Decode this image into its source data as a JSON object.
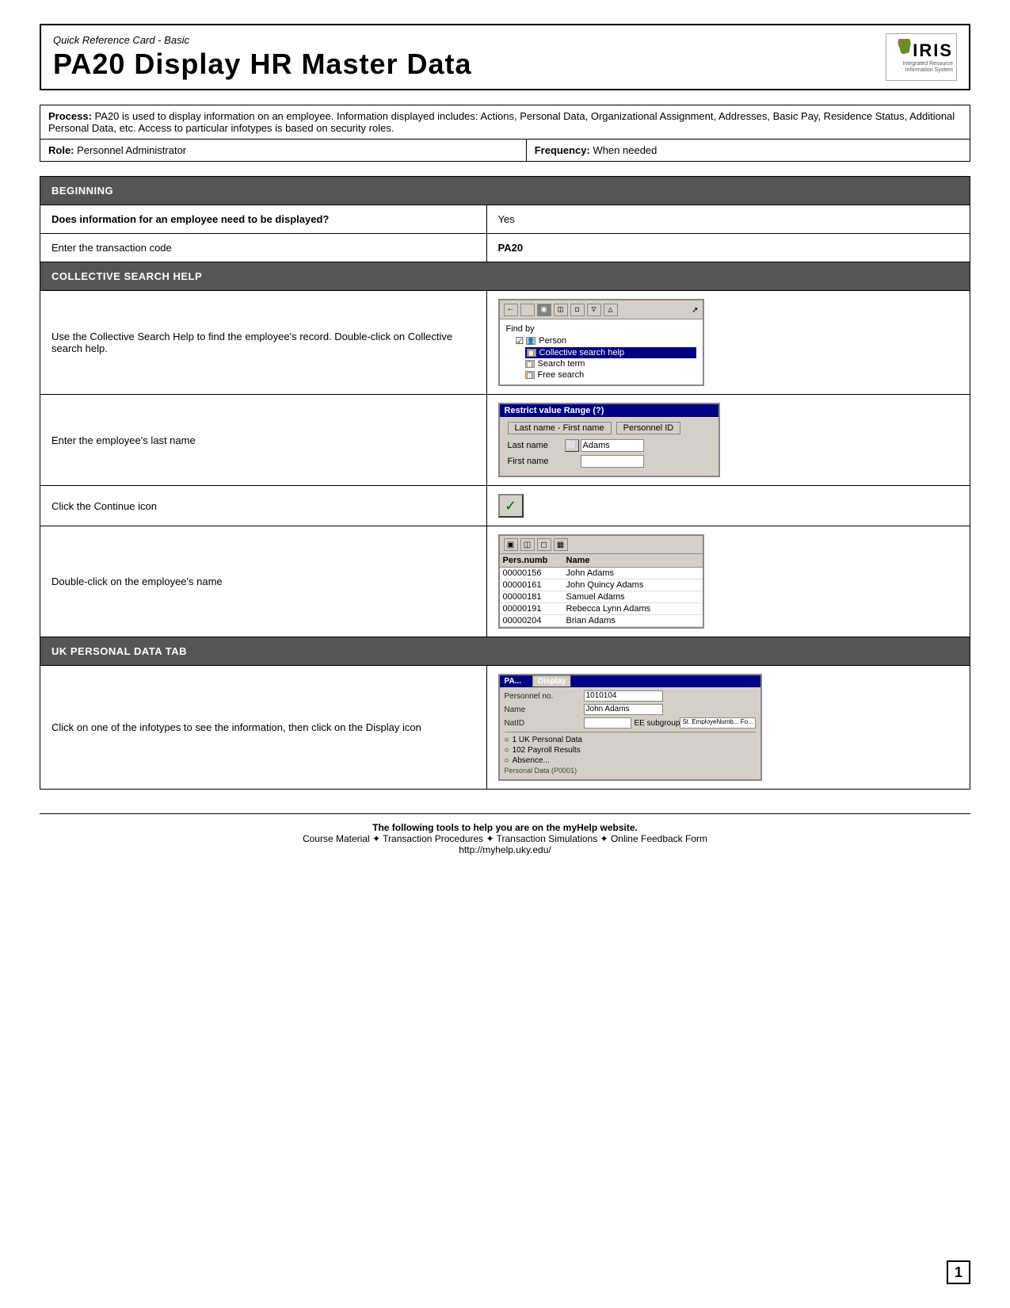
{
  "header": {
    "subtitle": "Quick Reference Card - Basic",
    "title": "PA20 Display HR Master Data",
    "logo_text": "IRIS",
    "logo_subtext": "Integrated Resource\nInformation System"
  },
  "process": {
    "label": "Process:",
    "text": "PA20 is used to display information on an employee. Information displayed includes: Actions, Personal Data, Organizational Assignment, Addresses, Basic Pay, Residence Status, Additional Personal Data, etc. Access to particular infotypes is based on security roles."
  },
  "role": {
    "label": "Role:",
    "value": "Personnel Administrator"
  },
  "frequency": {
    "label": "Frequency:",
    "value": "When needed"
  },
  "sections": [
    {
      "header": "BEGINNING",
      "rows": [
        {
          "left": "Does information for an employee need to be displayed?",
          "right": "Yes",
          "type": "text"
        },
        {
          "left": "Enter the transaction code",
          "right": "PA20",
          "type": "text"
        }
      ]
    },
    {
      "header": "COLLECTIVE SEARCH HELP",
      "rows": [
        {
          "left": "Use the Collective Search Help to find the employee's record. Double-click on Collective search help.",
          "right": "screenshot_search_tree",
          "type": "screenshot_search_tree"
        },
        {
          "left": "Enter the employee's last name",
          "right": "screenshot_search_range",
          "type": "screenshot_search_range"
        },
        {
          "left": "Click the Continue icon",
          "right": "screenshot_continue",
          "type": "screenshot_continue"
        },
        {
          "left": "Double-click on the employee's name",
          "right": "screenshot_emp_list",
          "type": "screenshot_emp_list"
        }
      ]
    },
    {
      "header": "UK PERSONAL DATA TAB",
      "rows": [
        {
          "left": "Click on one of the infotypes to see the information, then click on the Display icon",
          "right": "screenshot_hr_master",
          "type": "screenshot_hr_master"
        }
      ]
    }
  ],
  "search_tree": {
    "title": "",
    "find_by": "Find by",
    "person": "Person",
    "collective": "Collective search help",
    "search_term": "Search term",
    "free_search": "Free search"
  },
  "search_range": {
    "title": "Restrict value Range (?)",
    "tab_lastname": "Last name - First name",
    "tab_personnelid": "Personnel ID",
    "label_lastname": "Last name",
    "value_lastname": "Adams",
    "label_firstname": "First name"
  },
  "continue_icon": {
    "symbol": "✓"
  },
  "emp_list": {
    "col1": "Pers.numb",
    "col2": "Name",
    "rows": [
      {
        "id": "00000156",
        "name": "John Adams"
      },
      {
        "id": "00000161",
        "name": "John Quincy Adams"
      },
      {
        "id": "00000181",
        "name": "Samuel Adams"
      },
      {
        "id": "00000191",
        "name": "Rebecca Lynn Adams"
      },
      {
        "id": "00000204",
        "name": "Brian Adams"
      }
    ]
  },
  "hr_master": {
    "title": "Display HR Master Data",
    "menu1": "PA...",
    "menu2": "Display",
    "field_persno_label": "Personnel no.",
    "field_persno_value": "1010104",
    "field_name_label": "Name",
    "field_name_value": "John Adams",
    "field_nat_label": "NatID",
    "field_nat_value": "",
    "field_ee_label": "EE subgroup",
    "field_ee_value": "St. EmployeNumb... Fo...",
    "infotype1": "1 UK Personal Data",
    "infotype2": "102 Payroll Results",
    "infotype3": "Absence...",
    "infotype4": "Personal Data (P0001)"
  },
  "footer": {
    "line1": "The following tools to help you are on the myHelp website.",
    "line2": "Course Material ✦ Transaction Procedures ✦ Transaction Simulations ✦ Online Feedback Form",
    "line3": "http://myhelp.uky.edu/"
  },
  "page_number": "1"
}
